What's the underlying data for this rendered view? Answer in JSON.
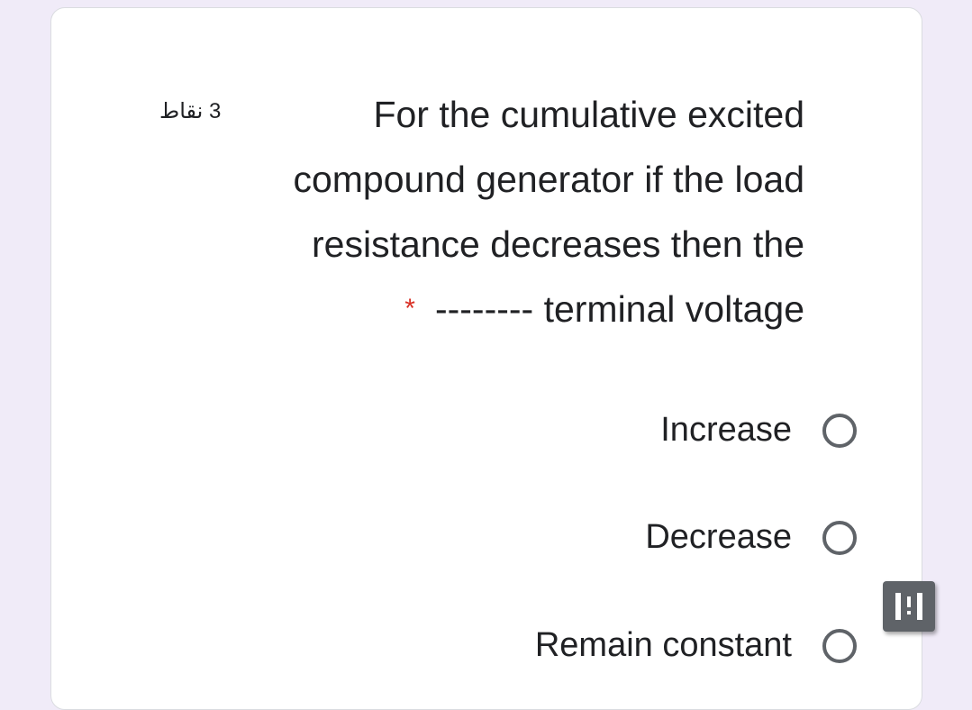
{
  "question": {
    "points": "3 نقاط",
    "lines": [
      "For the cumulative excited",
      "compound generator if the load",
      "resistance decreases then the",
      "-------- terminal voltage"
    ],
    "required_marker": "*"
  },
  "options": [
    {
      "label": "Increase",
      "selected": false
    },
    {
      "label": "Decrease",
      "selected": false
    },
    {
      "label": "Remain constant",
      "selected": false
    }
  ],
  "floating_button": {
    "icon": "import-question-icon"
  }
}
